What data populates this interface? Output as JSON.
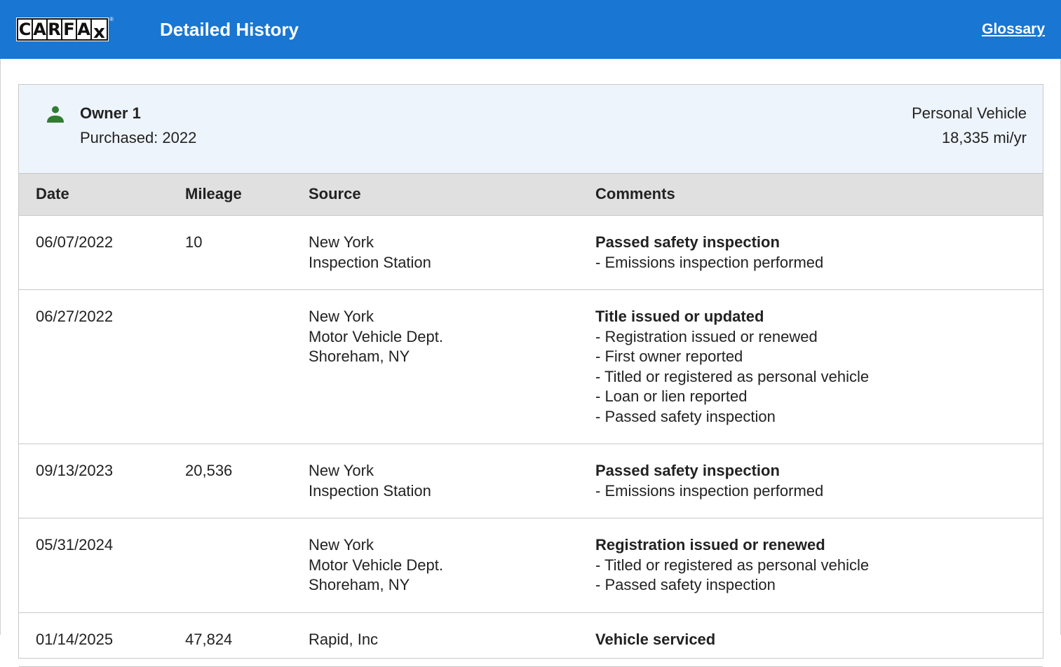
{
  "header": {
    "logo_letters": [
      "C",
      "A",
      "R",
      "F",
      "A",
      "x"
    ],
    "logo_reg": "®",
    "title": "Detailed History",
    "glossary_label": "Glossary",
    "bg_color": "#1976d2"
  },
  "owner": {
    "icon": "person-icon",
    "icon_color": "#2e7d32",
    "name": "Owner 1",
    "purchased": "Purchased: 2022",
    "vehicle_type": "Personal Vehicle",
    "miles_per_year": "18,335 mi/yr"
  },
  "table": {
    "headers": {
      "date": "Date",
      "mileage": "Mileage",
      "source": "Source",
      "comments": "Comments"
    },
    "rows": [
      {
        "date": "06/07/2022",
        "mileage": "10",
        "source": [
          "New York",
          "Inspection Station"
        ],
        "comment_title": "Passed safety inspection",
        "comment_items": [
          "- Emissions inspection performed"
        ]
      },
      {
        "date": "06/27/2022",
        "mileage": "",
        "source": [
          "New York",
          "Motor Vehicle Dept.",
          "Shoreham, NY"
        ],
        "comment_title": "Title issued or updated",
        "comment_items": [
          "- Registration issued or renewed",
          "- First owner reported",
          "- Titled or registered as personal vehicle",
          "- Loan or lien reported",
          "- Passed safety inspection"
        ]
      },
      {
        "date": "09/13/2023",
        "mileage": "20,536",
        "source": [
          "New York",
          "Inspection Station"
        ],
        "comment_title": "Passed safety inspection",
        "comment_items": [
          "- Emissions inspection performed"
        ]
      },
      {
        "date": "05/31/2024",
        "mileage": "",
        "source": [
          "New York",
          "Motor Vehicle Dept.",
          "Shoreham, NY"
        ],
        "comment_title": "Registration issued or renewed",
        "comment_items": [
          "- Titled or registered as personal vehicle",
          "- Passed safety inspection"
        ]
      },
      {
        "date": "01/14/2025",
        "mileage": "47,824",
        "source": [
          "Rapid, Inc"
        ],
        "comment_title": "Vehicle serviced",
        "comment_items": []
      }
    ]
  }
}
